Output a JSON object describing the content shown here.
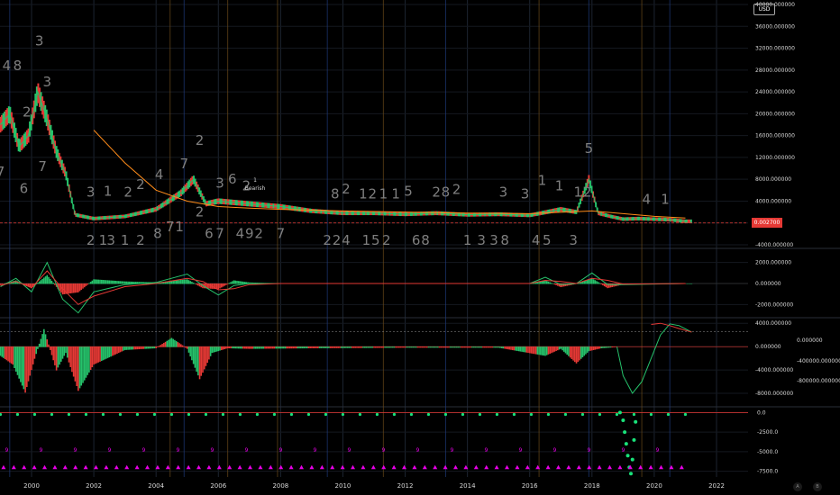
{
  "currency": "USD",
  "current_price_label": "0.002700",
  "annotation": {
    "number": "1",
    "label": "Bearish"
  },
  "x_axis": {
    "years": [
      "2000",
      "2002",
      "2004",
      "2006",
      "2008",
      "2010",
      "2012",
      "2014",
      "2016",
      "2018",
      "2020",
      "2022"
    ]
  },
  "corner_buttons": [
    "A",
    "B"
  ],
  "chart_data": [
    {
      "pane": "price",
      "type": "line",
      "currency": "USD",
      "ylim": [
        -4000,
        40000
      ],
      "y_ticks": [
        "40000.000000",
        "36000.000000",
        "32000.000000",
        "28000.000000",
        "24000.000000",
        "20000.000000",
        "16000.000000",
        "12000.000000",
        "8000.000000",
        "4000.000000",
        "0.000000",
        "-4000.000000"
      ],
      "last_price": "0.002700",
      "series": [
        {
          "color": "#26c26b",
          "x": [
            1999.0,
            1999.3,
            1999.6,
            1999.9,
            2000.2,
            2000.5,
            2000.8,
            2001.1,
            2001.4,
            2002.0,
            2003.0,
            2004.0,
            2004.8,
            2005.2,
            2005.6,
            2006.0,
            2007.0,
            2008.0,
            2009.0,
            2010.0,
            2011.0,
            2012.0,
            2013.0,
            2014.0,
            2015.0,
            2016.0,
            2017.0,
            2017.5,
            2017.9,
            2018.2,
            2018.6,
            2019.0,
            2019.5,
            2020.0,
            2020.5,
            2021.0
          ],
          "values": [
            18000,
            20000,
            14000,
            16000,
            24000,
            19000,
            13000,
            9000,
            1500,
            800,
            1200,
            2500,
            5500,
            8000,
            3500,
            4000,
            3500,
            3000,
            2200,
            1800,
            1800,
            1600,
            1800,
            1500,
            1600,
            1400,
            2500,
            2000,
            8000,
            1800,
            1200,
            700,
            800,
            700,
            600,
            300
          ]
        },
        {
          "color": "#ff8c1a",
          "x": [
            2002.0,
            2003.0,
            2004.0,
            2005.0,
            2006.0,
            2007.0,
            2008.0,
            2010.0,
            2012.0,
            2014.0,
            2016.0,
            2018.0,
            2020.0,
            2021.0
          ],
          "values": [
            17000,
            11000,
            6000,
            4000,
            3000,
            2700,
            2500,
            2200,
            2000,
            1800,
            1700,
            2200,
            1200,
            900
          ]
        }
      ],
      "wave_labels": [
        {
          "text": "4",
          "x": 1999.2,
          "y": 28000
        },
        {
          "text": "8",
          "x": 1999.55,
          "y": 28000
        },
        {
          "text": "3",
          "x": 2000.25,
          "y": 32500
        },
        {
          "text": "3",
          "x": 2000.5,
          "y": 25000
        },
        {
          "text": "2",
          "x": 1999.85,
          "y": 19500
        },
        {
          "text": "7",
          "x": 1999.0,
          "y": 8500
        },
        {
          "text": "6",
          "x": 1999.75,
          "y": 5500
        },
        {
          "text": "7",
          "x": 2000.35,
          "y": 9500
        },
        {
          "text": "3",
          "x": 2001.9,
          "y": 4800
        },
        {
          "text": "1",
          "x": 2002.45,
          "y": 5000
        },
        {
          "text": "2",
          "x": 2003.1,
          "y": 4800
        },
        {
          "text": "2",
          "x": 2003.5,
          "y": 6200
        },
        {
          "text": "4",
          "x": 2004.1,
          "y": 8000
        },
        {
          "text": "7",
          "x": 2004.9,
          "y": 10000
        },
        {
          "text": "2",
          "x": 2005.4,
          "y": 14300
        },
        {
          "text": "3",
          "x": 2006.05,
          "y": 6500
        },
        {
          "text": "6",
          "x": 2006.45,
          "y": 7200
        },
        {
          "text": "2",
          "x": 2006.9,
          "y": 6000
        },
        {
          "text": "8",
          "x": 2009.75,
          "y": 4500
        },
        {
          "text": "2",
          "x": 2010.1,
          "y": 5400
        },
        {
          "text": "1",
          "x": 2010.65,
          "y": 4500
        },
        {
          "text": "2",
          "x": 2010.95,
          "y": 4500
        },
        {
          "text": "1",
          "x": 2011.3,
          "y": 4500
        },
        {
          "text": "1",
          "x": 2011.7,
          "y": 4500
        },
        {
          "text": "5",
          "x": 2012.1,
          "y": 5000
        },
        {
          "text": "2",
          "x": 2013.0,
          "y": 4800
        },
        {
          "text": "8",
          "x": 2013.3,
          "y": 4800
        },
        {
          "text": "2",
          "x": 2013.65,
          "y": 5300
        },
        {
          "text": "3",
          "x": 2015.15,
          "y": 4800
        },
        {
          "text": "3",
          "x": 2015.85,
          "y": 4500
        },
        {
          "text": "1",
          "x": 2016.4,
          "y": 7000
        },
        {
          "text": "1",
          "x": 2016.95,
          "y": 6000
        },
        {
          "text": "1",
          "x": 2017.55,
          "y": 4800
        },
        {
          "text": "2",
          "x": 2017.85,
          "y": 4800
        },
        {
          "text": "5",
          "x": 2017.9,
          "y": 12800
        },
        {
          "text": "4",
          "x": 2019.75,
          "y": 3500
        },
        {
          "text": "1",
          "x": 2020.35,
          "y": 3500
        },
        {
          "text": "2",
          "x": 2005.4,
          "y": 1200
        },
        {
          "text": "7",
          "x": 2004.45,
          "y": -1500
        },
        {
          "text": "1",
          "x": 2004.75,
          "y": -1500
        },
        {
          "text": "2",
          "x": 2001.9,
          "y": -4000
        },
        {
          "text": "1",
          "x": 2002.3,
          "y": -4000
        },
        {
          "text": "3",
          "x": 2002.55,
          "y": -4000
        },
        {
          "text": "1",
          "x": 2003.0,
          "y": -4000
        },
        {
          "text": "2",
          "x": 2003.5,
          "y": -4000
        },
        {
          "text": "8",
          "x": 2004.05,
          "y": -2800
        },
        {
          "text": "6",
          "x": 2005.7,
          "y": -2800
        },
        {
          "text": "7",
          "x": 2006.05,
          "y": -2800
        },
        {
          "text": "4",
          "x": 2006.7,
          "y": -2800
        },
        {
          "text": "9",
          "x": 2007.0,
          "y": -2800
        },
        {
          "text": "2",
          "x": 2007.3,
          "y": -2800
        },
        {
          "text": "7",
          "x": 2008.0,
          "y": -2800
        },
        {
          "text": "2",
          "x": 2009.5,
          "y": -4000
        },
        {
          "text": "2",
          "x": 2009.8,
          "y": -4000
        },
        {
          "text": "4",
          "x": 2010.1,
          "y": -4000
        },
        {
          "text": "1",
          "x": 2010.75,
          "y": -4000
        },
        {
          "text": "5",
          "x": 2011.05,
          "y": -4000
        },
        {
          "text": "2",
          "x": 2011.4,
          "y": -4000
        },
        {
          "text": "6",
          "x": 2012.35,
          "y": -4000
        },
        {
          "text": "8",
          "x": 2012.65,
          "y": -4000
        },
        {
          "text": "1",
          "x": 2014.0,
          "y": -4000
        },
        {
          "text": "3",
          "x": 2014.45,
          "y": -4000
        },
        {
          "text": "3",
          "x": 2014.85,
          "y": -4000
        },
        {
          "text": "8",
          "x": 2015.2,
          "y": -4000
        },
        {
          "text": "4",
          "x": 2016.2,
          "y": -4000
        },
        {
          "text": "5",
          "x": 2016.55,
          "y": -4000
        },
        {
          "text": "3",
          "x": 2017.4,
          "y": -4000
        }
      ]
    },
    {
      "pane": "macd",
      "type": "line",
      "ylim": [
        -3000,
        3000
      ],
      "y_ticks": [
        "2000.000000",
        "0.000000",
        "-2000.000000"
      ],
      "series": [
        {
          "color": "#26c26b",
          "x": [
            1999.0,
            1999.5,
            2000.0,
            2000.5,
            2001.0,
            2001.5,
            2002.0,
            2003.0,
            2004.0,
            2005.0,
            2005.5,
            2006.0,
            2006.5,
            2007.0,
            2008.0,
            2012.0,
            2016.0,
            2016.5,
            2017.0,
            2017.5,
            2018.0,
            2018.5,
            2019.0,
            2021.0
          ],
          "values": [
            -300,
            500,
            -800,
            2000,
            -1500,
            -2800,
            -800,
            -100,
            100,
            900,
            -200,
            -1100,
            -200,
            0,
            0,
            0,
            0,
            600,
            -100,
            0,
            1000,
            -100,
            -100,
            0
          ]
        },
        {
          "color": "#e53935",
          "x": [
            1999.0,
            1999.5,
            2000.0,
            2000.5,
            2001.0,
            2001.5,
            2002.0,
            2003.0,
            2004.0,
            2005.0,
            2005.5,
            2006.0,
            2006.5,
            2007.0,
            2008.0,
            2012.0,
            2016.0,
            2016.5,
            2017.0,
            2017.5,
            2018.0,
            2018.5,
            2019.0,
            2021.0
          ],
          "values": [
            -200,
            200,
            -400,
            1200,
            -500,
            -2000,
            -1200,
            -300,
            0,
            500,
            200,
            -600,
            -500,
            -100,
            0,
            0,
            0,
            300,
            200,
            0,
            500,
            300,
            -50,
            0
          ]
        }
      ]
    },
    {
      "pane": "oscillator",
      "type": "line",
      "ylim": [
        -10000,
        4500
      ],
      "y_ticks": [
        "4000.000000",
        "0.000000",
        "-4000.000000",
        "-8000.000000"
      ],
      "secondary_y_ticks": [
        "0.000000",
        "-400000.000000",
        "-800000.000000"
      ],
      "series": [
        {
          "color": "#26c26b",
          "x": [
            2018.8,
            2019.0,
            2019.3,
            2019.6,
            2019.9,
            2020.2,
            2020.5,
            2020.8,
            2021.2
          ],
          "values": [
            0,
            -5000,
            -8000,
            -6000,
            -2000,
            2000,
            3900,
            3600,
            2500
          ]
        },
        {
          "color": "#e53935",
          "x": [
            2019.9,
            2020.2,
            2020.5,
            2020.8,
            2021.2
          ],
          "values": [
            3800,
            4000,
            3600,
            3100,
            2500
          ]
        }
      ]
    },
    {
      "pane": "signals",
      "type": "scatter",
      "ylim": [
        -8000,
        500
      ],
      "y_ticks": [
        "0.0",
        "-2500.0",
        "-5000.0",
        "-7500.0"
      ],
      "series": [
        {
          "color": "#19e27a",
          "x": [
            2018.9,
            2019.0,
            2019.05,
            2019.1,
            2019.15,
            2019.2,
            2019.25,
            2019.3,
            2019.35,
            2019.4
          ],
          "values": [
            0,
            -1000,
            -2500,
            -4000,
            -5500,
            -7000,
            -7800,
            -6000,
            -3500,
            -1200
          ]
        }
      ],
      "markers": {
        "count_label": "9",
        "triangle_color": "#e600e6"
      }
    }
  ]
}
